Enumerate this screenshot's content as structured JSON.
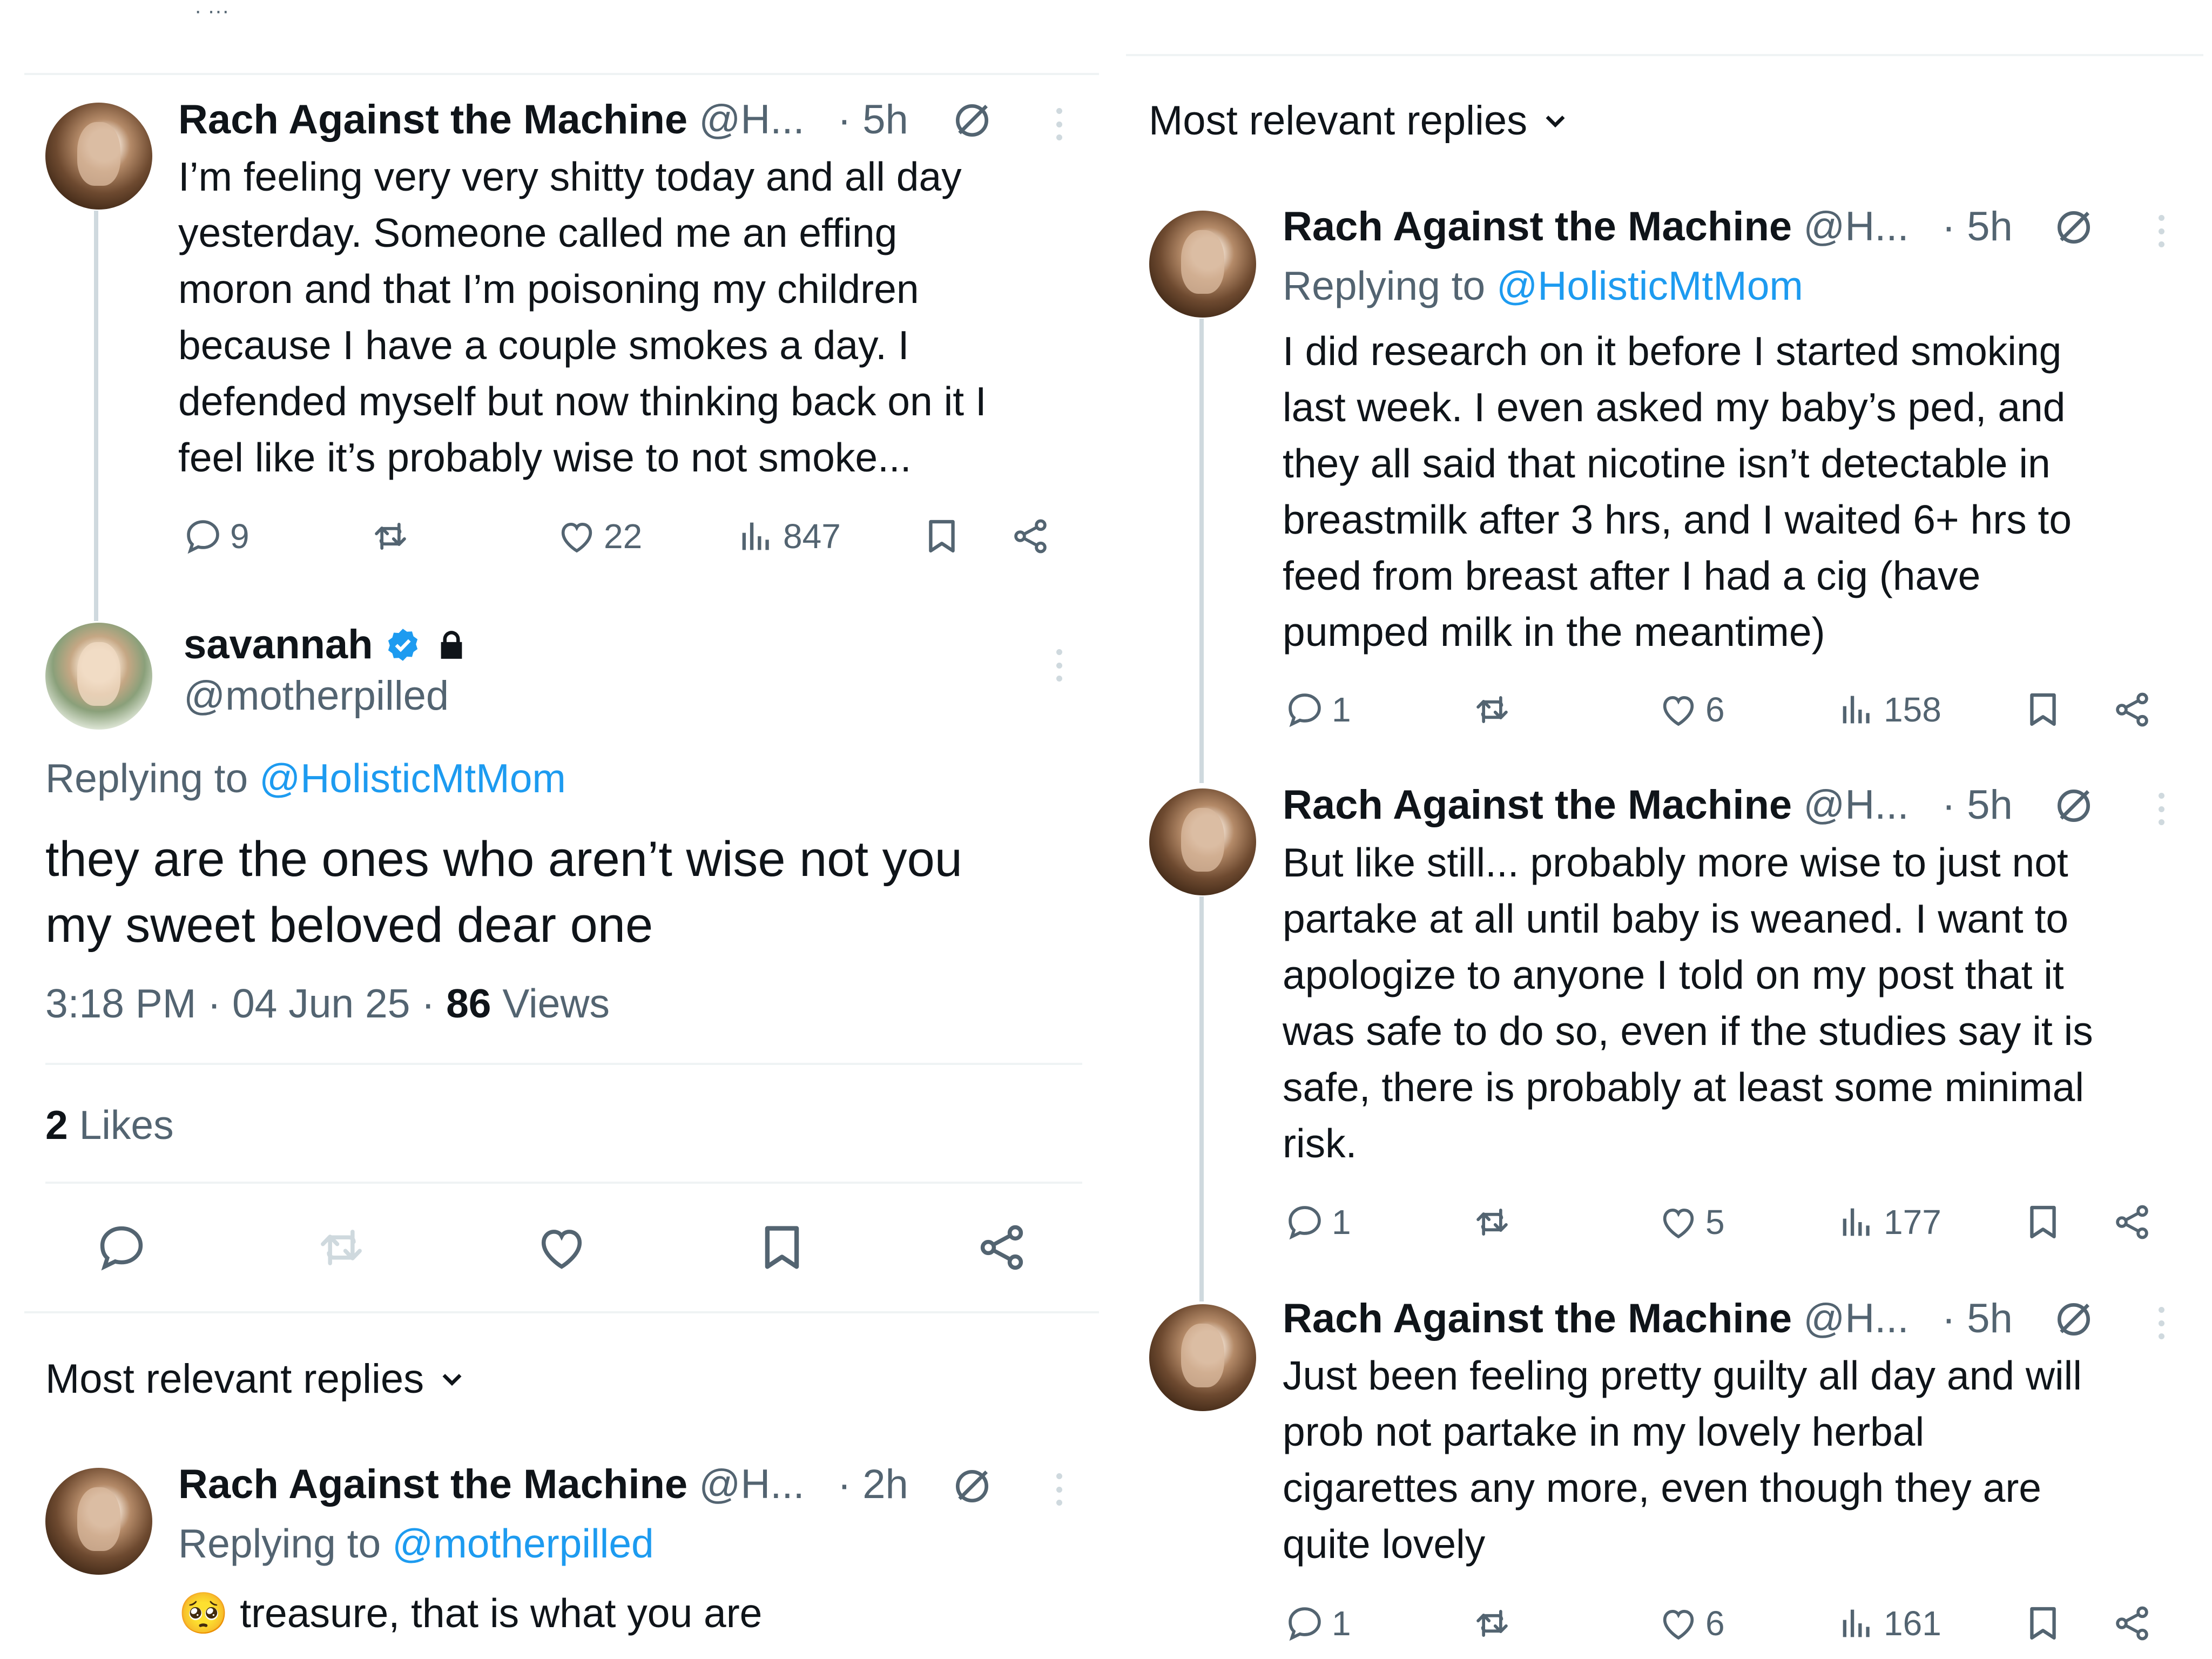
{
  "top_cutoff_text": "· ···",
  "left_thread": {
    "parent": {
      "author": "Rach Against the Machine",
      "handle": "@H...",
      "time": "· 5h",
      "text_lines": [
        "I’m feeling very very shitty today and all day",
        "yesterday. Someone called me an effing",
        "moron and that I’m poisoning my children",
        "because I have a couple smokes a day. I",
        "defended myself but now thinking back on it I",
        "feel like it’s probably wise to not smoke..."
      ],
      "replies": "9",
      "likes": "22",
      "views": "847"
    },
    "main": {
      "author": "savannah",
      "handle": "@motherpilled",
      "replying_prefix": "Replying to",
      "replying_to": "@HolisticMtMom",
      "text_lines": [
        "they are the ones who aren’t wise not you",
        "my sweet beloved dear one"
      ],
      "time": "3:18 PM · 04 Jun 25 ·",
      "views_count": "86",
      "views_label": "Views",
      "likes_count": "2",
      "likes_label": "Likes"
    },
    "sort_label": "Most relevant replies",
    "reply": {
      "author": "Rach Against the Machine",
      "handle": "@H...",
      "time": "· 2h",
      "replying_prefix": "Replying to",
      "replying_to": "@motherpilled",
      "emoji": "🥺",
      "text": "treasure, that is what you are"
    }
  },
  "right_thread": {
    "sort_label": "Most relevant replies",
    "replies": [
      {
        "author": "Rach Against the Machine",
        "handle": "@H...",
        "time": "· 5h",
        "replying_prefix": "Replying to",
        "replying_to": "@HolisticMtMom",
        "text_lines": [
          "I did research on it before I started smoking",
          "last week. I even asked my baby’s ped, and",
          "they all said that nicotine isn’t detectable in",
          "breastmilk after 3 hrs, and I waited 6+ hrs to",
          "feed from breast after I had a cig (have",
          "pumped milk in the meantime)"
        ],
        "replies": "1",
        "likes": "6",
        "views": "158"
      },
      {
        "author": "Rach Against the Machine",
        "handle": "@H...",
        "time": "· 5h",
        "text_lines": [
          "But like still... probably more wise to just not",
          "partake at all until baby is weaned. I want to",
          "apologize to anyone I told on my post that it",
          "was safe to do so, even if the studies say it is",
          "safe, there is probably at least some minimal",
          "risk."
        ],
        "replies": "1",
        "likes": "5",
        "views": "177"
      },
      {
        "author": "Rach Against the Machine",
        "handle": "@H...",
        "time": "· 5h",
        "text_lines": [
          "Just been feeling pretty guilty all day and will",
          "prob not partake in my lovely herbal",
          "cigarettes any more, even though they are",
          "quite lovely"
        ],
        "replies": "1",
        "likes": "6",
        "views": "161"
      }
    ]
  },
  "colors": {
    "text": "#0f1419",
    "secondary": "#536471",
    "link": "#1d9bf0",
    "divider": "#eff3f4",
    "thread_line": "#cfd9de"
  }
}
